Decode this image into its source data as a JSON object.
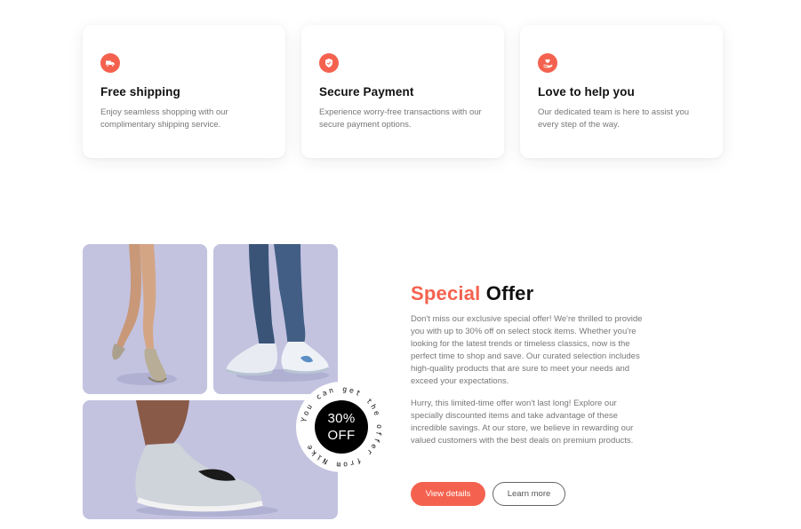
{
  "features": [
    {
      "icon": "truck-icon",
      "title": "Free shipping",
      "description": "Enjoy seamless shopping with our complimentary shipping service."
    },
    {
      "icon": "shield-icon",
      "title": "Secure Payment",
      "description": "Experience worry-free transactions with our secure payment options."
    },
    {
      "icon": "heart-hand-icon",
      "title": "Love to help you",
      "description": "Our dedicated team is here to assist you every step of the way."
    }
  ],
  "offer": {
    "title_accent": "Special",
    "title_rest": "Offer",
    "paragraph1": "Don't miss our exclusive special offer! We're thrilled to provide you with up to 30% off on select stock items. Whether you're looking for the latest trends or timeless classics, now is the perfect time to shop and save. Our curated selection includes high-quality products that are sure to meet your needs and exceed your expectations.",
    "paragraph2": "Hurry, this limited-time offer won't last long! Explore our specially discounted items and take advantage of these incredible savings. At our store, we believe in rewarding our valued customers with the best deals on premium products.",
    "primary_button": "View details",
    "secondary_button": "Learn more"
  },
  "badge": {
    "line1": "30%",
    "line2": "OFF",
    "ring_text": "You can get the offer from Nike "
  },
  "colors": {
    "accent": "#f4624f",
    "tile_background": "#c3c3e0"
  }
}
